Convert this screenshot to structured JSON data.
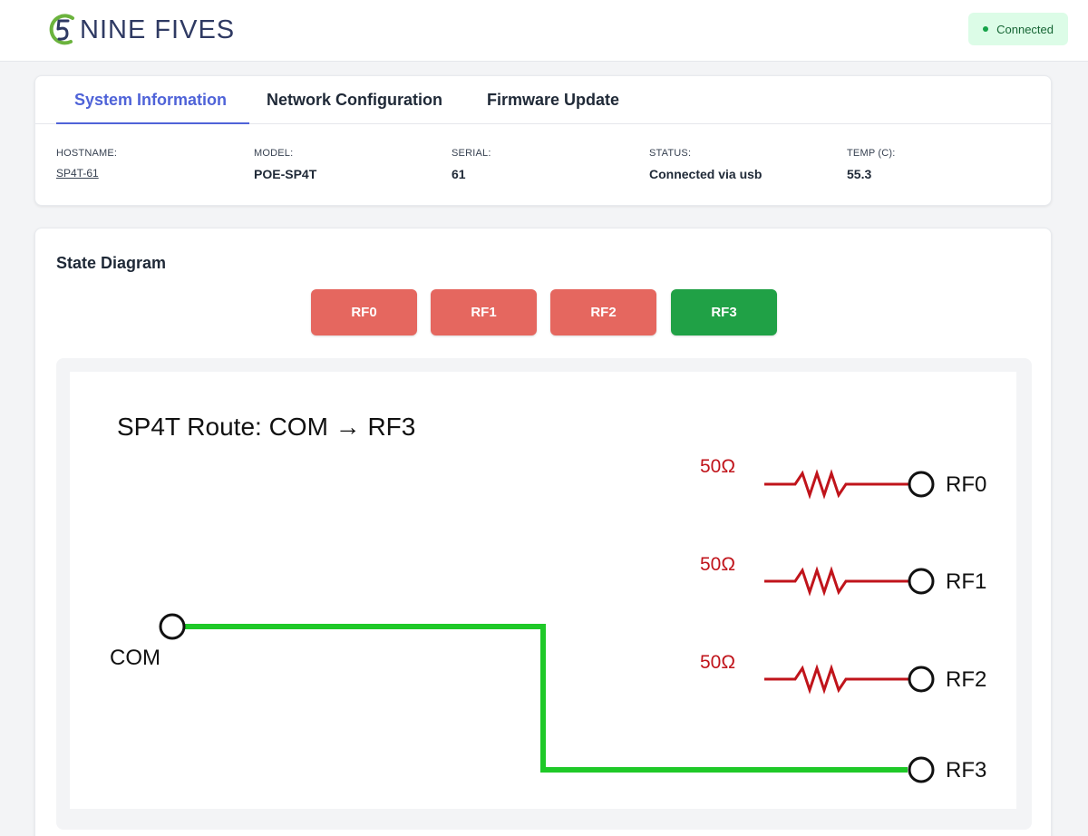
{
  "header": {
    "logo_text": "NINE FIVES",
    "connection_badge": "Connected",
    "colors": {
      "logo_green": "#6bb33d",
      "logo_navy": "#2f3a63",
      "badge_bg": "#dcfce7",
      "badge_text": "#166534"
    }
  },
  "tabs": [
    {
      "label": "System Information",
      "active": true
    },
    {
      "label": "Network Configuration",
      "active": false
    },
    {
      "label": "Firmware Update",
      "active": false
    }
  ],
  "system_info": {
    "hostname": {
      "label": "HOSTNAME:",
      "value": "SP4T-61"
    },
    "model": {
      "label": "MODEL:",
      "value": "POE-SP4T"
    },
    "serial": {
      "label": "SERIAL:",
      "value": "61"
    },
    "status": {
      "label": "STATUS:",
      "value": "Connected via usb"
    },
    "temp": {
      "label": "TEMP (C):",
      "value": "55.3"
    }
  },
  "state_diagram": {
    "title": "State Diagram",
    "buttons": [
      {
        "label": "RF0",
        "active": false
      },
      {
        "label": "RF1",
        "active": false
      },
      {
        "label": "RF2",
        "active": false
      },
      {
        "label": "RF3",
        "active": true
      }
    ],
    "route_title": "SP4T Route: COM → RF3",
    "com_label": "COM",
    "ports": [
      {
        "label": "RF0",
        "terminated": true,
        "termination_label": "50Ω"
      },
      {
        "label": "RF1",
        "terminated": true,
        "termination_label": "50Ω"
      },
      {
        "label": "RF2",
        "terminated": true,
        "termination_label": "50Ω"
      },
      {
        "label": "RF3",
        "terminated": false,
        "termination_label": ""
      }
    ],
    "colors": {
      "active_button": "#20a146",
      "inactive_button": "#e5675f",
      "route_line": "#1fc928",
      "termination": "#c0141b"
    }
  }
}
